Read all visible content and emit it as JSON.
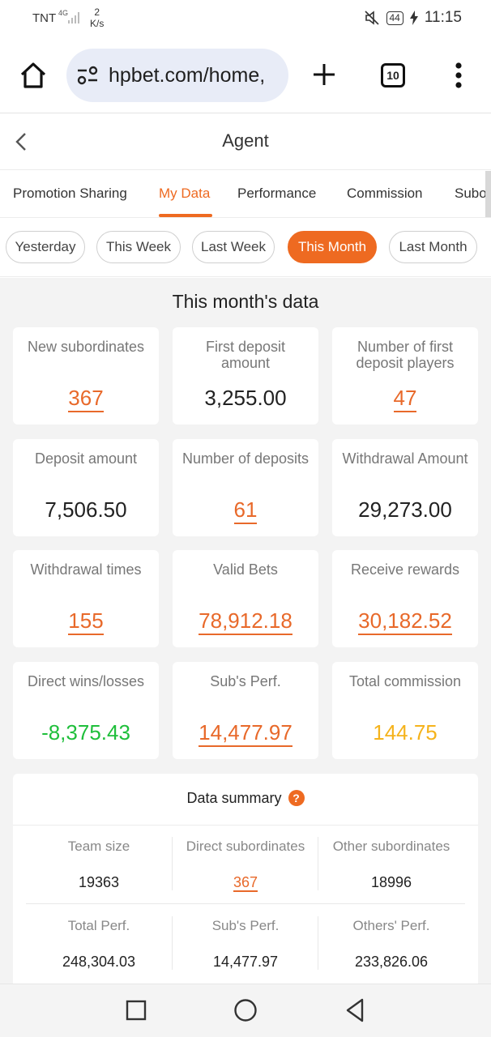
{
  "status_bar": {
    "carrier": "TNT",
    "network": "4G",
    "speed_value": "2",
    "speed_unit": "K/s",
    "battery": "44",
    "time": "11:15",
    "icons": [
      "mute-icon",
      "battery-icon",
      "charging-icon"
    ]
  },
  "browser": {
    "url": "hpbet.com/home,",
    "tab_count": "10",
    "icons": [
      "home-icon",
      "tune-icon",
      "plus-icon",
      "tabs-icon",
      "more-vert-icon"
    ]
  },
  "page": {
    "title": "Agent"
  },
  "tabs": [
    {
      "label": "Promotion Sharing",
      "active": false
    },
    {
      "label": "My Data",
      "active": true
    },
    {
      "label": "Performance",
      "active": false
    },
    {
      "label": "Commission",
      "active": false
    },
    {
      "label": "Subo",
      "active": false
    }
  ],
  "periods": [
    {
      "label": "Yesterday",
      "active": false
    },
    {
      "label": "This Week",
      "active": false
    },
    {
      "label": "Last Week",
      "active": false
    },
    {
      "label": "This Month",
      "active": true
    },
    {
      "label": "Last Month",
      "active": false
    }
  ],
  "section_title": "This month's data",
  "stats": [
    {
      "label": "New subordinates",
      "value": "367",
      "style": "link"
    },
    {
      "label": "First deposit amount",
      "value": "3,255.00",
      "style": "plain"
    },
    {
      "label": "Number of first deposit players",
      "value": "47",
      "style": "link"
    },
    {
      "label": "Deposit amount",
      "value": "7,506.50",
      "style": "plain"
    },
    {
      "label": "Number of deposits",
      "value": "61",
      "style": "link"
    },
    {
      "label": "Withdrawal Amount",
      "value": "29,273.00",
      "style": "plain"
    },
    {
      "label": "Withdrawal times",
      "value": "155",
      "style": "link"
    },
    {
      "label": "Valid Bets",
      "value": "78,912.18",
      "style": "link"
    },
    {
      "label": "Receive rewards",
      "value": "30,182.52",
      "style": "link"
    },
    {
      "label": "Direct wins/losses",
      "value": "-8,375.43",
      "style": "green"
    },
    {
      "label": "Sub's Perf.",
      "value": "14,477.97",
      "style": "link"
    },
    {
      "label": "Total commission",
      "value": "144.75",
      "style": "gold"
    }
  ],
  "summary": {
    "title": "Data summary",
    "help": "?",
    "rows": [
      [
        {
          "label": "Team size",
          "value": "19363",
          "link": false
        },
        {
          "label": "Direct subordinates",
          "value": "367",
          "link": true
        },
        {
          "label": "Other subordinates",
          "value": "18996",
          "link": false
        }
      ],
      [
        {
          "label": "Total Perf.",
          "value": "248,304.03",
          "link": false
        },
        {
          "label": "Sub's Perf.",
          "value": "14,477.97",
          "link": false
        },
        {
          "label": "Others' Perf.",
          "value": "233,826.06",
          "link": false
        }
      ]
    ]
  },
  "accent_color": "#ee6a21",
  "positive_color": "#1fbf3b",
  "commission_color": "#f5b31c"
}
